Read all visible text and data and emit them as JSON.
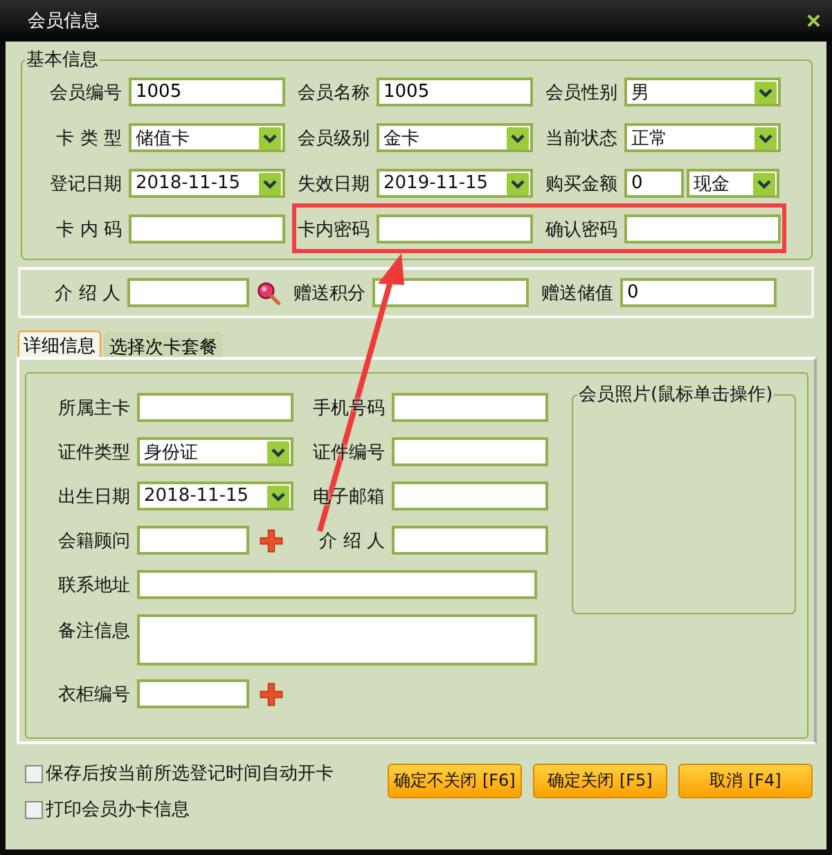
{
  "window": {
    "title": "会员信息",
    "close": "×"
  },
  "basic_info": {
    "title": "基本信息",
    "fields": [
      {
        "label": "会员编号",
        "kind": "text",
        "value": "1005"
      },
      {
        "label": "会员名称",
        "kind": "text",
        "value": "1005"
      },
      {
        "label": "会员性别",
        "kind": "select",
        "value": "男"
      },
      {
        "label": "卡 类 型",
        "kind": "select",
        "value": "储值卡"
      },
      {
        "label": "会员级别",
        "kind": "select",
        "value": "金卡"
      },
      {
        "label": "当前状态",
        "kind": "select",
        "value": "正常"
      },
      {
        "label": "登记日期",
        "kind": "select",
        "value": "2018-11-15"
      },
      {
        "label": "失效日期",
        "kind": "select",
        "value": "2019-11-15"
      },
      {
        "label": "购买金额",
        "kind": "amount",
        "value": "0",
        "currency": "现金"
      },
      {
        "label": "卡 内 码",
        "kind": "text"
      },
      {
        "label": "卡内密码",
        "kind": "text"
      },
      {
        "label": "确认密码",
        "kind": "text"
      }
    ]
  },
  "referral": {
    "fields": [
      {
        "label": "介 绍 人",
        "kind": "search"
      },
      {
        "label": "赠送积分",
        "kind": "text"
      },
      {
        "label": "赠送储值",
        "kind": "text",
        "value": "0"
      }
    ]
  },
  "tabs": [
    {
      "label": "详细信息",
      "selected": true
    },
    {
      "label": "选择次卡套餐",
      "selected": false
    }
  ],
  "detail": {
    "fields": [
      {
        "label": "所属主卡",
        "kind": "text"
      },
      {
        "label": "手机号码",
        "kind": "text"
      },
      {
        "label": "证件类型",
        "kind": "select",
        "value": "身份证"
      },
      {
        "label": "证件编号",
        "kind": "text"
      },
      {
        "label": "出生日期",
        "kind": "select",
        "value": "2018-11-15"
      },
      {
        "label": "电子邮箱",
        "kind": "text"
      },
      {
        "label": "会籍顾问",
        "kind": "plus"
      },
      {
        "label": "介 绍 人",
        "kind": "text"
      },
      {
        "label": "联系地址",
        "kind": "wide"
      },
      {
        "label": "备注信息",
        "kind": "memo"
      },
      {
        "label": "衣柜编号",
        "kind": "plus"
      }
    ],
    "photo": {
      "title": "会员照片(鼠标单击操作)"
    }
  },
  "options": [
    {
      "label": "保存后按当前所选登记时间自动开卡",
      "checked": false
    },
    {
      "label": "打印会员办卡信息",
      "checked": false
    }
  ],
  "buttons": [
    "确定不关闭 [F6]",
    "确定关闭 [F5]",
    "取消 [F4]"
  ]
}
